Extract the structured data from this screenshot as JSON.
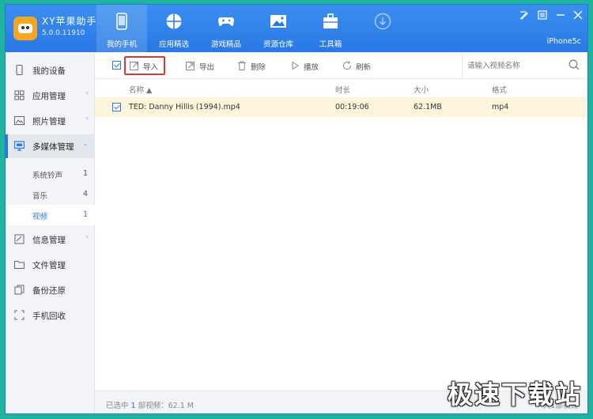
{
  "app": {
    "title": "XY苹果助手",
    "version": "5.0.0.11910",
    "device_name": "iPhone5c"
  },
  "nav_tabs": [
    {
      "label": "我的手机",
      "icon": "phone-icon",
      "active": true
    },
    {
      "label": "应用精选",
      "icon": "app-store-icon",
      "active": false
    },
    {
      "label": "游戏精品",
      "icon": "gamepad-icon",
      "active": false
    },
    {
      "label": "资源仓库",
      "icon": "image-icon",
      "active": false
    },
    {
      "label": "工具箱",
      "icon": "toolbox-icon",
      "active": false
    },
    {
      "label": "",
      "icon": "download-icon",
      "active": false
    }
  ],
  "sidebar": {
    "items": [
      {
        "label": "我的设备",
        "icon": "device-icon"
      },
      {
        "label": "应用管理",
        "icon": "grid-icon"
      },
      {
        "label": "照片管理",
        "icon": "photo-icon"
      },
      {
        "label": "多媒体管理",
        "icon": "monitor-icon"
      },
      {
        "label": "信息管理",
        "icon": "message-icon"
      },
      {
        "label": "文件管理",
        "icon": "folder-icon"
      },
      {
        "label": "备份还原",
        "icon": "backup-icon"
      },
      {
        "label": "手机回收",
        "icon": "recycle-icon"
      }
    ],
    "sub_items": [
      {
        "label": "系统铃声",
        "count": "1"
      },
      {
        "label": "音乐",
        "count": "4"
      },
      {
        "label": "视频",
        "count": "1"
      }
    ]
  },
  "toolbar": {
    "import_label": "导入",
    "export_label": "导出",
    "delete_label": "删除",
    "play_label": "播放",
    "refresh_label": "刷新",
    "search_placeholder": "请输入视频名称"
  },
  "table": {
    "columns": [
      "名称 ▲",
      "时长",
      "大小",
      "格式"
    ],
    "rows": [
      {
        "name": "TED: Danny Hillis (1994).mp4",
        "duration": "00:19:06",
        "size": "62.1MB",
        "format": "mp4"
      }
    ]
  },
  "status": {
    "prefix": "已选中",
    "count": "1",
    "suffix": "部视频：62.1 M",
    "right": "共1部视频"
  },
  "watermark": "极速下载站",
  "colors": {
    "background": "#20b4a0",
    "header": "#2a78e4",
    "selected_row": "#fdf6dd",
    "highlight_border": "#d9383a"
  }
}
